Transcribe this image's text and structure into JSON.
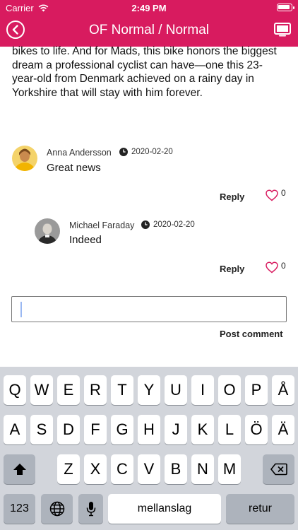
{
  "status_bar": {
    "carrier": "Carrier",
    "time": "2:49 PM"
  },
  "nav": {
    "title": "OF Normal / Normal"
  },
  "article": {
    "text": "bikes to life. And for Mads, this bike honors the biggest dream a professional cyclist can have—one this 23-year-old from Denmark achieved on a rainy day in Yorkshire that will stay with him forever."
  },
  "comments": [
    {
      "author": "Anna Andersson",
      "date": "2020-02-20",
      "text": "Great news",
      "reply_label": "Reply",
      "likes": "0"
    },
    {
      "author": "Michael Faraday",
      "date": "2020-02-20",
      "text": "Indeed",
      "reply_label": "Reply",
      "likes": "0"
    }
  ],
  "comment_box": {
    "value": "",
    "post_label": "Post comment"
  },
  "keyboard": {
    "row1": [
      "Q",
      "W",
      "E",
      "R",
      "T",
      "Y",
      "U",
      "I",
      "O",
      "P",
      "Å"
    ],
    "row2": [
      "A",
      "S",
      "D",
      "F",
      "G",
      "H",
      "J",
      "K",
      "L",
      "Ö",
      "Ä"
    ],
    "row3": [
      "Z",
      "X",
      "C",
      "V",
      "B",
      "N",
      "M"
    ],
    "numbers_label": "123",
    "space_label": "mellanslag",
    "return_label": "retur"
  },
  "colors": {
    "accent": "#d81b5f",
    "keyboard_bg": "#d2d5db"
  }
}
